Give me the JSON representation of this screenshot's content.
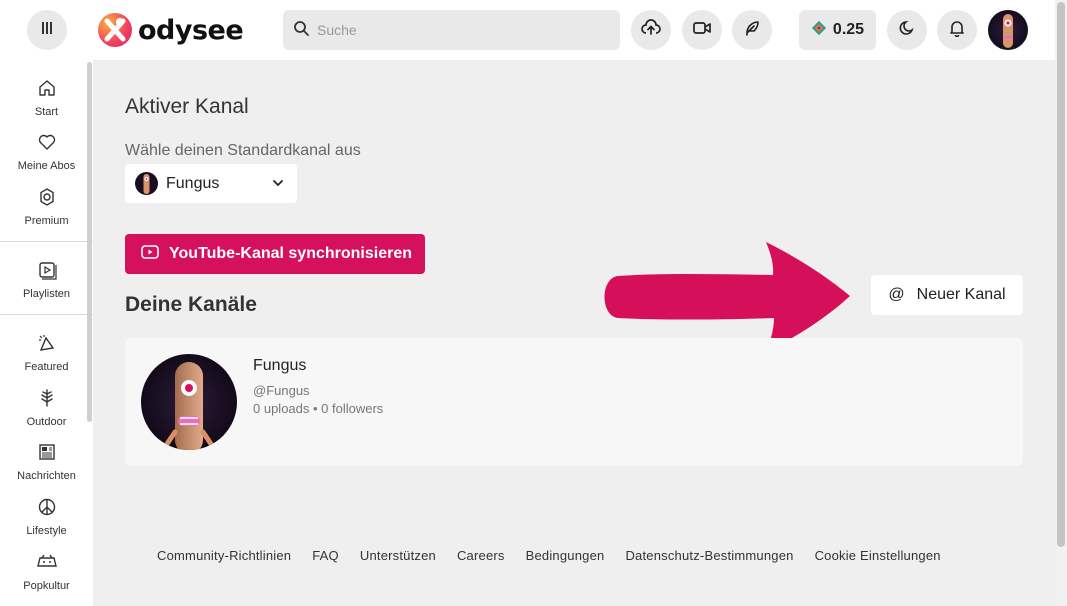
{
  "header": {
    "logo_text": "odysee",
    "search": {
      "placeholder": "Suche"
    },
    "wallet_balance": "0.25",
    "icons": [
      "menu-icon",
      "upload-icon",
      "video-camera-icon",
      "feather-icon",
      "moon-icon",
      "bell-icon"
    ]
  },
  "sidebar": {
    "items": [
      {
        "label": "Start",
        "icon": "home-icon"
      },
      {
        "label": "Meine Abos",
        "icon": "heart-icon"
      },
      {
        "label": "Premium",
        "icon": "premium-badge-icon"
      },
      {
        "label": "Playlisten",
        "icon": "playlist-icon"
      },
      {
        "label": "Featured",
        "icon": "featured-icon"
      },
      {
        "label": "Outdoor",
        "icon": "tree-icon"
      },
      {
        "label": "Nachrichten",
        "icon": "newspaper-icon"
      },
      {
        "label": "Lifestyle",
        "icon": "peace-icon"
      },
      {
        "label": "Popkultur",
        "icon": "popculture-icon"
      }
    ]
  },
  "main": {
    "active_title": "Aktiver Kanal",
    "choose_label": "Wähle deinen Standardkanal aus",
    "selected_channel": "Fungus",
    "youtube_sync_label": "YouTube-Kanal synchronisieren",
    "your_channels_title": "Deine Kanäle",
    "new_channel_label": "Neuer Kanal",
    "channel_card": {
      "name": "Fungus",
      "handle": "@Fungus",
      "stats": "0 uploads • 0 followers"
    },
    "accent_color": "#d5115e"
  },
  "footer": {
    "links": [
      "Community-Richtlinien",
      "FAQ",
      "Unterstützen",
      "Careers",
      "Bedingungen",
      "Datenschutz-Bestimmungen",
      "Cookie Einstellungen"
    ]
  }
}
